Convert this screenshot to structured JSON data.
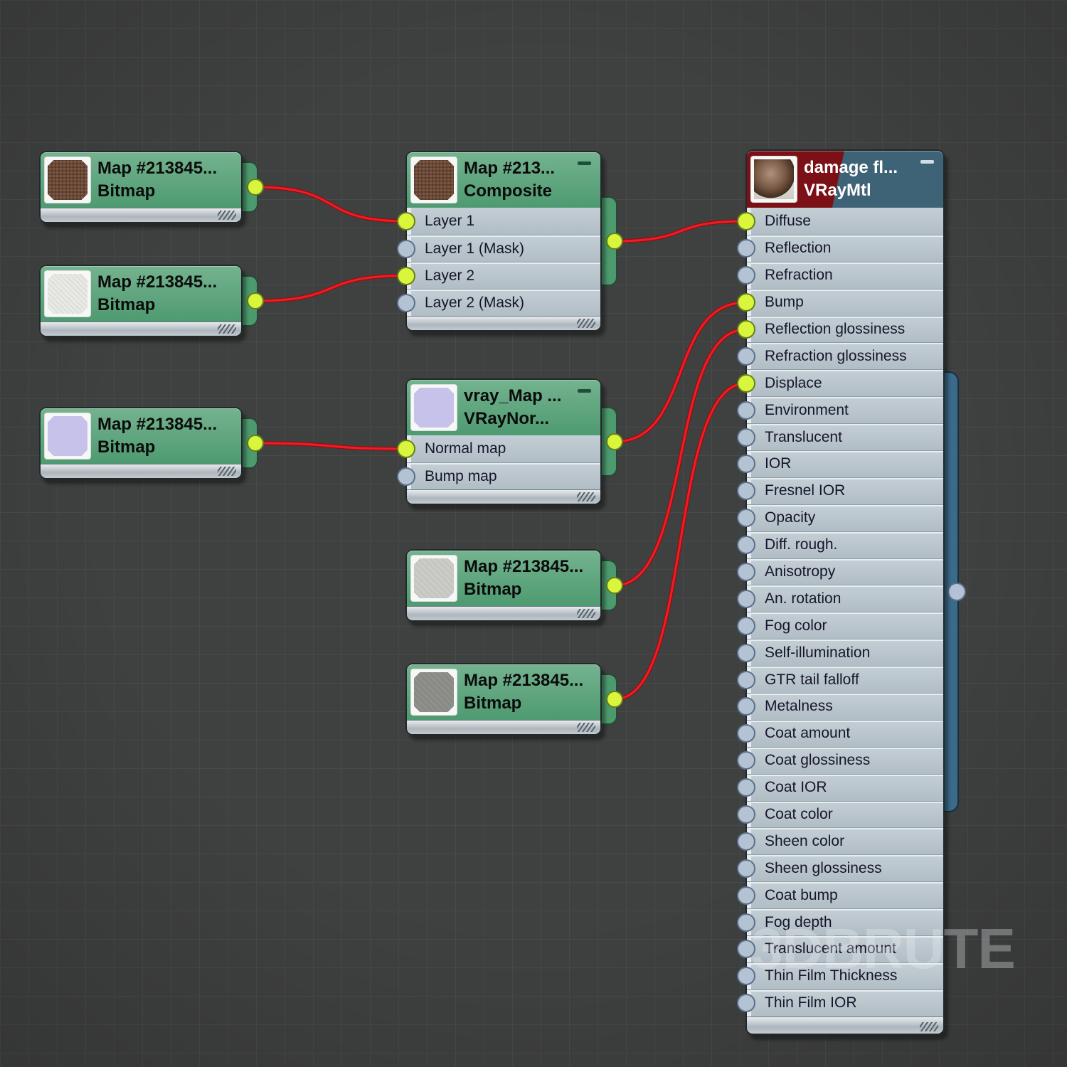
{
  "canvas": {
    "background": "#3f4040",
    "grid_color": "#484949"
  },
  "colors": {
    "wire": "#ee1c23",
    "wire_dark": "#8f0e12",
    "port_connected": "#d9f63c",
    "port_empty": "#b3c3d3",
    "header_green": "#5aa078",
    "header_maroon": "#7b1016",
    "header_slate": "#3e6377"
  },
  "watermark": {
    "text": "3DBRUTE"
  },
  "nodes": {
    "bitmap1": {
      "title": "Map #213845...",
      "subtitle": "Bitmap"
    },
    "bitmap2": {
      "title": "Map #213845...",
      "subtitle": "Bitmap"
    },
    "bitmap3": {
      "title": "Map #213845...",
      "subtitle": "Bitmap"
    },
    "bitmap4": {
      "title": "Map #213845...",
      "subtitle": "Bitmap"
    },
    "bitmap5": {
      "title": "Map #213845...",
      "subtitle": "Bitmap"
    },
    "composite": {
      "title": "Map #213...",
      "subtitle": "Composite",
      "slots": [
        {
          "label": "Layer 1",
          "connected": true
        },
        {
          "label": "Layer 1 (Mask)",
          "connected": false
        },
        {
          "label": "Layer 2",
          "connected": true
        },
        {
          "label": "Layer 2 (Mask)",
          "connected": false
        }
      ]
    },
    "vraynormal": {
      "title": "vray_Map ...",
      "subtitle": "VRayNor...",
      "slots": [
        {
          "label": "Normal map",
          "connected": true
        },
        {
          "label": "Bump map",
          "connected": false
        }
      ]
    },
    "vraymtl": {
      "title": "damage fl...",
      "subtitle": "VRayMtl",
      "slots": [
        {
          "label": "Diffuse",
          "connected": true
        },
        {
          "label": "Reflection",
          "connected": false
        },
        {
          "label": "Refraction",
          "connected": false
        },
        {
          "label": "Bump",
          "connected": true
        },
        {
          "label": "Reflection glossiness",
          "connected": true
        },
        {
          "label": "Refraction glossiness",
          "connected": false
        },
        {
          "label": "Displace",
          "connected": true
        },
        {
          "label": "Environment",
          "connected": false
        },
        {
          "label": "Translucent",
          "connected": false
        },
        {
          "label": "IOR",
          "connected": false
        },
        {
          "label": "Fresnel IOR",
          "connected": false
        },
        {
          "label": "Opacity",
          "connected": false
        },
        {
          "label": "Diff. rough.",
          "connected": false
        },
        {
          "label": "Anisotropy",
          "connected": false
        },
        {
          "label": "An. rotation",
          "connected": false
        },
        {
          "label": "Fog color",
          "connected": false
        },
        {
          "label": "Self-illumination",
          "connected": false
        },
        {
          "label": "GTR tail falloff",
          "connected": false
        },
        {
          "label": "Metalness",
          "connected": false
        },
        {
          "label": "Coat amount",
          "connected": false
        },
        {
          "label": "Coat glossiness",
          "connected": false
        },
        {
          "label": "Coat IOR",
          "connected": false
        },
        {
          "label": "Coat color",
          "connected": false
        },
        {
          "label": "Sheen color",
          "connected": false
        },
        {
          "label": "Sheen glossiness",
          "connected": false
        },
        {
          "label": "Coat bump",
          "connected": false
        },
        {
          "label": "Fog depth",
          "connected": false
        },
        {
          "label": "Translucent amount",
          "connected": false
        },
        {
          "label": "Thin Film Thickness",
          "connected": false
        },
        {
          "label": "Thin Film IOR",
          "connected": false
        }
      ]
    }
  },
  "connections": [
    {
      "from": "bitmap1-out",
      "to": "composite-in-0"
    },
    {
      "from": "bitmap2-out",
      "to": "composite-in-2"
    },
    {
      "from": "bitmap3-out",
      "to": "vraynormal-in-0"
    },
    {
      "from": "composite-out",
      "to": "vraymtl-in-0"
    },
    {
      "from": "vraynormal-out",
      "to": "vraymtl-in-3"
    },
    {
      "from": "bitmap4-out",
      "to": "vraymtl-in-4"
    },
    {
      "from": "bitmap5-out",
      "to": "vraymtl-in-6"
    }
  ]
}
